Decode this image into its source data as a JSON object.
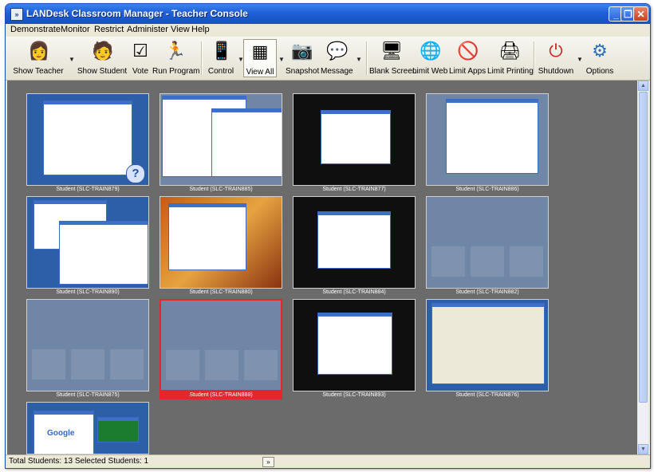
{
  "window": {
    "title": "LANDesk Classroom Manager - Teacher Console"
  },
  "menu": [
    "Demonstrate",
    "Monitor",
    "Restrict",
    "Administer",
    "View",
    "Help"
  ],
  "toolbar": [
    {
      "label": "Show Teacher",
      "icon": "teacher-icon"
    },
    {
      "label": "Show Student",
      "icon": "student-icon"
    },
    {
      "label": "Vote",
      "icon": "vote-icon"
    },
    {
      "label": "Run Program",
      "icon": "run-program-icon"
    },
    {
      "label": "Control",
      "icon": "remote-control-icon"
    },
    {
      "label": "View All",
      "icon": "view-all-icon"
    },
    {
      "label": "Snapshot",
      "icon": "camera-icon"
    },
    {
      "label": "Message",
      "icon": "message-icon"
    },
    {
      "label": "Blank Screen",
      "icon": "blank-screen-icon"
    },
    {
      "label": "Limit Web",
      "icon": "limit-web-icon"
    },
    {
      "label": "Limit Apps",
      "icon": "limit-apps-icon"
    },
    {
      "label": "Limit Printing",
      "icon": "printer-icon"
    },
    {
      "label": "Shutdown",
      "icon": "shutdown-icon"
    },
    {
      "label": "Options",
      "icon": "options-gear-icon"
    }
  ],
  "students": [
    {
      "name": "Student (SLC-TRAIN879)",
      "screen": "classic-needs-help"
    },
    {
      "name": "Student (SLC-TRAIN885)",
      "screen": "desktop-windows"
    },
    {
      "name": "Student (SLC-TRAIN877)",
      "screen": "black-desktop"
    },
    {
      "name": "Student (SLC-TRAIN886)",
      "screen": "blue-desktop-window"
    },
    {
      "name": "Student (SLC-TRAIN890)",
      "screen": "classic-spreadsheet"
    },
    {
      "name": "Student (SLC-TRAIN880)",
      "screen": "autumn-desktop"
    },
    {
      "name": "Student (SLC-TRAIN884)",
      "screen": "black-desktop"
    },
    {
      "name": "Student (SLC-TRAIN882)",
      "screen": "blue-idle"
    },
    {
      "name": "Student (SLC-TRAIN875)",
      "screen": "blue-idle"
    },
    {
      "name": "Student (SLC-TRAIN888)",
      "screen": "blue-idle",
      "selected": true
    },
    {
      "name": "Student (SLC-TRAIN893)",
      "screen": "black-desktop"
    },
    {
      "name": "Student (SLC-TRAIN876)",
      "screen": "classic-dialog"
    },
    {
      "name": "",
      "screen": "google-browser"
    }
  ],
  "screen_texts": {
    "google_logo": "Google"
  },
  "status": {
    "text": "Total Students: 13  Selected Students: 1",
    "expand_icon": "»"
  }
}
